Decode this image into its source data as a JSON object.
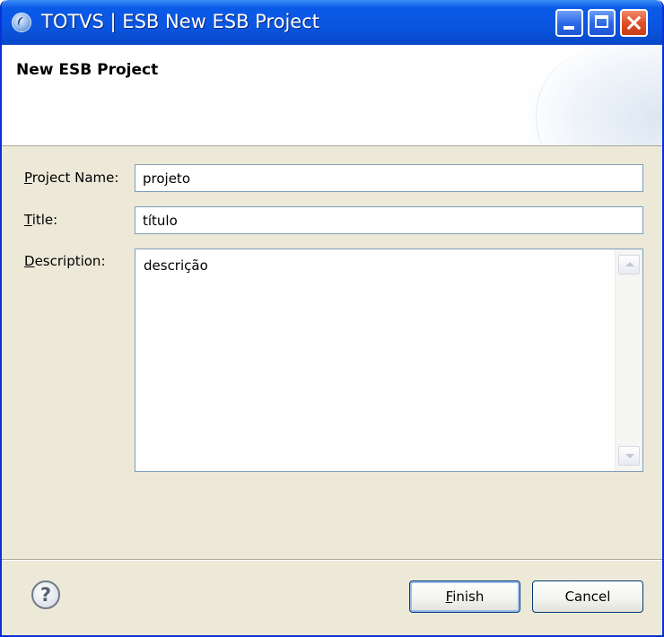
{
  "window": {
    "title": "TOTVS | ESB New ESB Project"
  },
  "banner": {
    "title": "New ESB Project"
  },
  "form": {
    "project_name": {
      "label_mnemonic": "P",
      "label_rest": "roject Name:",
      "value": "projeto"
    },
    "title": {
      "label_mnemonic": "T",
      "label_rest": "itle:",
      "value": "título"
    },
    "description": {
      "label_mnemonic": "D",
      "label_rest": "escription:",
      "value": "descrição"
    }
  },
  "footer": {
    "help_symbol": "?",
    "finish": {
      "mnemonic": "F",
      "rest": "inish"
    },
    "cancel_label": "Cancel"
  },
  "colors": {
    "titlebar": "#0a55e0",
    "dialog_bg": "#ece9d8",
    "field_border": "#7f9db9",
    "close_button": "#e0502c"
  }
}
